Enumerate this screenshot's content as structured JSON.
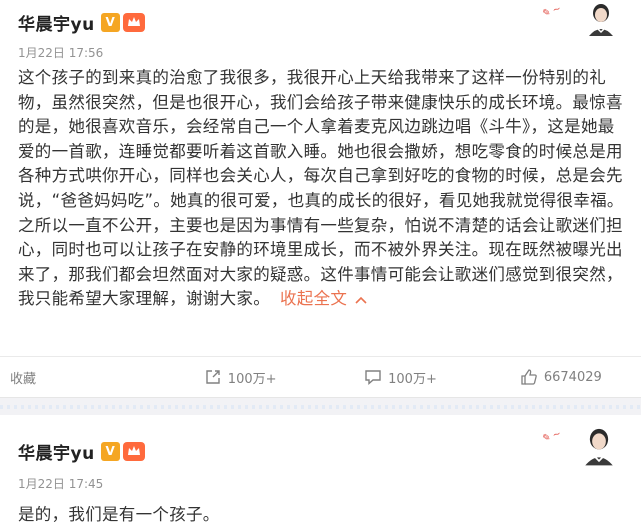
{
  "posts": [
    {
      "author": "华晨宇yu",
      "verified_badge": "V",
      "time": "1月22日 17:56",
      "text": "这个孩子的到来真的治愈了我很多，我很开心上天给我带来了这样一份特别的礼物，虽然很突然，但是也很开心，我们会给孩子带来健康快乐的成长环境。最惊喜的是，她很喜欢音乐，会经常自己一个人拿着麦克风边跳边唱《斗牛》，这是她最爱的一首歌，连睡觉都要听着这首歌入睡。她也很会撒娇，想吃零食的时候总是用各种方式哄你开心，同样也会关心人，每次自己拿到好吃的食物的时候，总是会先说，“爸爸妈妈吃”。她真的很可爱，也真的成长的很好，看见她我就觉得很幸福。之所以一直不公开，主要也是因为事情有一些复杂，怕说不清楚的话会让歌迷们担心，同时也可以让孩子在安静的环境里成长，而不被外界关注。现在既然被曝光出来了，那我们都会坦然面对大家的疑惑。这件事情可能会让歌迷们感觉到很突然，我只能希望大家理解，谢谢大家。",
      "collapse_label": "收起全文",
      "actions": {
        "favorite": "收藏",
        "repost": "100万+",
        "comment": "100万+",
        "like": "6674029"
      }
    },
    {
      "author": "华晨宇yu",
      "verified_badge": "V",
      "time": "1月22日 17:45",
      "text": "是的，我们是有一个孩子。"
    }
  ],
  "icons": {
    "crown": "crown-icon",
    "repost": "share-icon",
    "comment": "comment-icon",
    "like": "thumb-up-icon",
    "collapse": "chevron-up-icon"
  },
  "colors": {
    "accent": "#eb7350",
    "verified": "#f5a623",
    "muted": "#939393"
  }
}
